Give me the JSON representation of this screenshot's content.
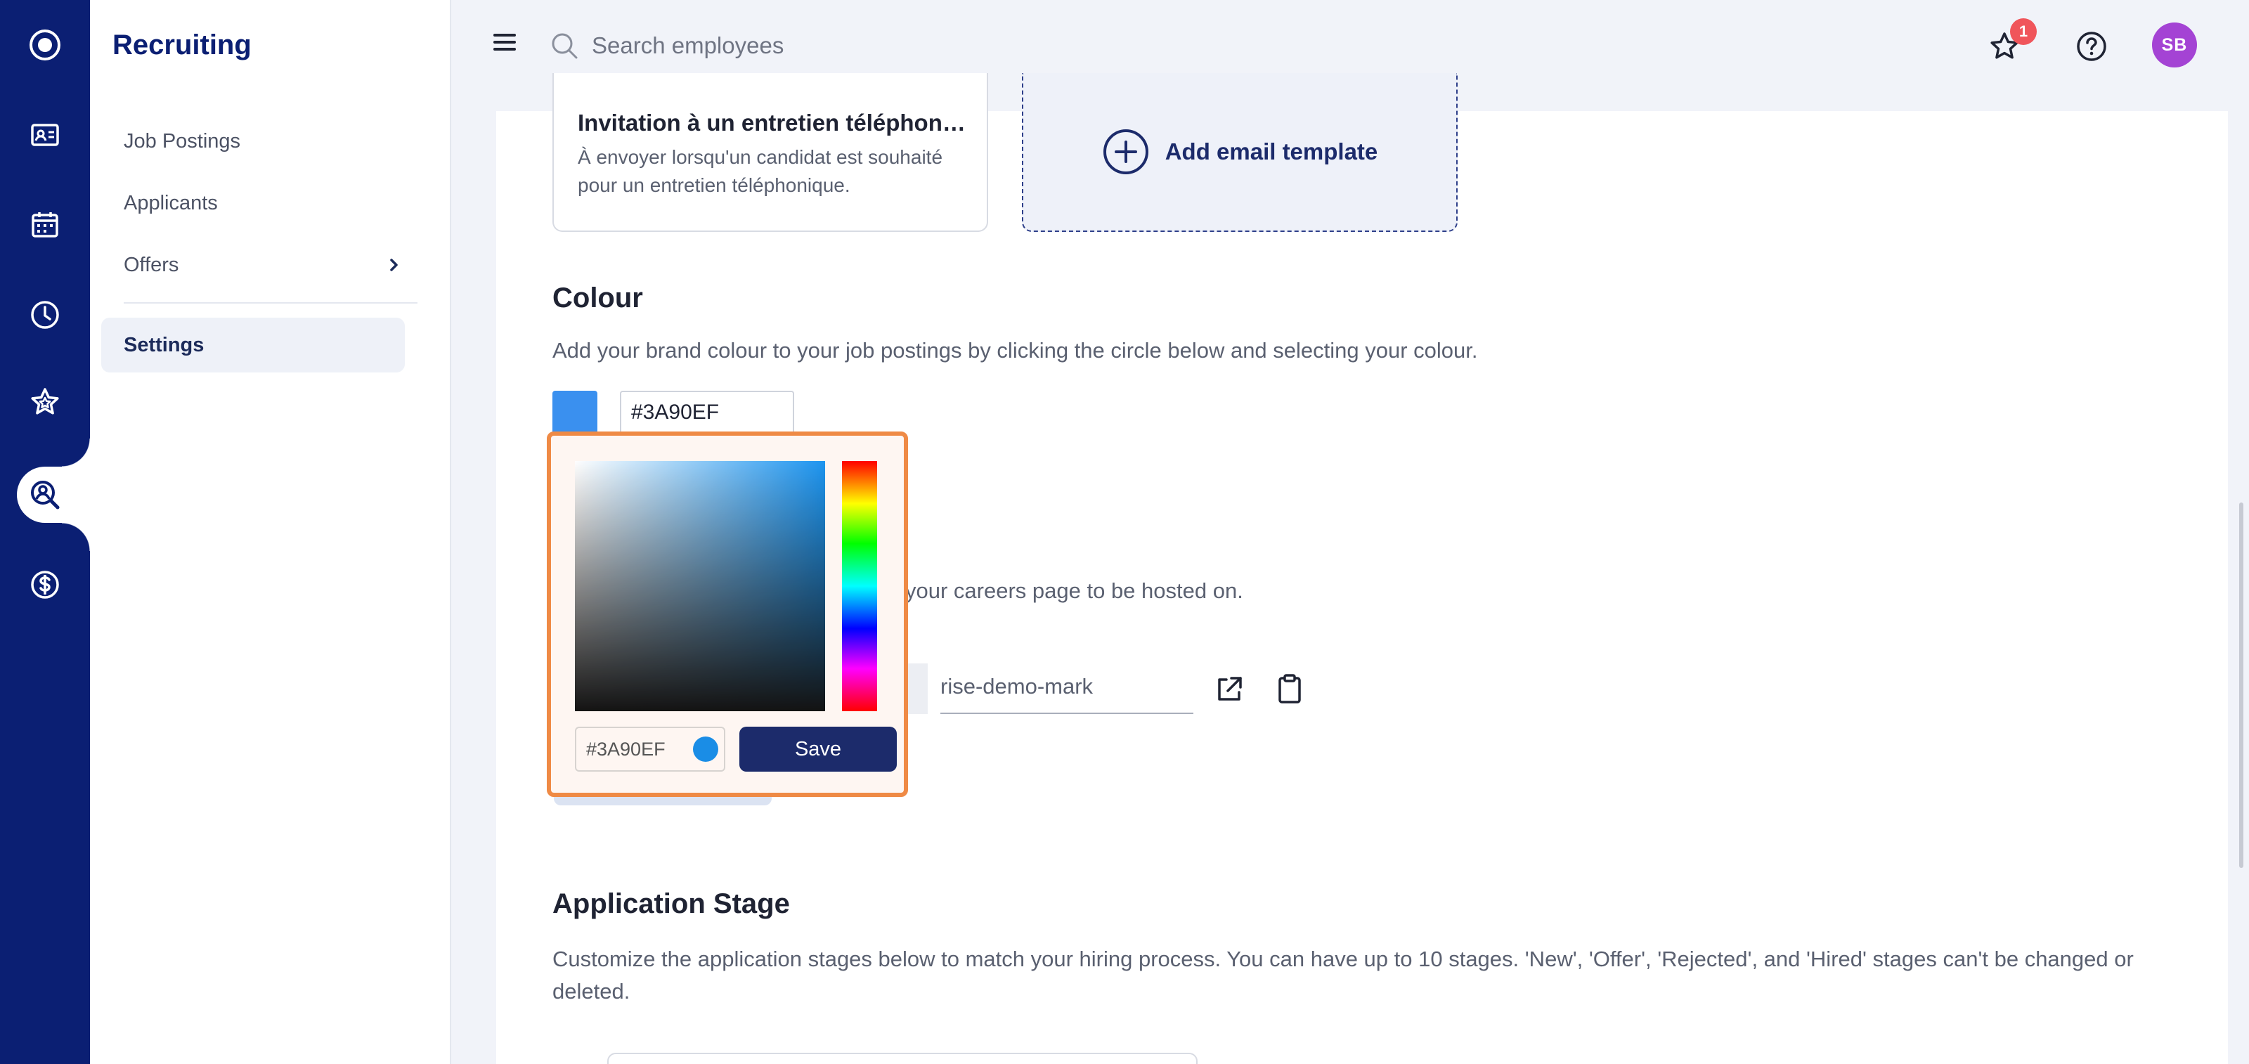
{
  "app": {
    "section_title": "Recruiting"
  },
  "rail": {
    "items": [
      {
        "icon": "logo-icon"
      },
      {
        "icon": "id-card-icon"
      },
      {
        "icon": "calendar-icon"
      },
      {
        "icon": "clock-icon"
      },
      {
        "icon": "star-icon"
      },
      {
        "icon": "search-person-icon",
        "active": true
      },
      {
        "icon": "dollar-icon"
      }
    ]
  },
  "subnav": {
    "items": [
      {
        "label": "Job Postings"
      },
      {
        "label": "Applicants"
      },
      {
        "label": "Offers"
      },
      {
        "label": "Settings",
        "active": true
      }
    ]
  },
  "topbar": {
    "search_placeholder": "Search employees",
    "notification_count": "1",
    "avatar_initials": "SB"
  },
  "email_templates": {
    "card_title": "Invitation à un entretien téléphonique",
    "card_desc": "À envoyer lorsqu'un candidat est souhaité pour un entretien téléphonique.",
    "add_label": "Add email template"
  },
  "colour": {
    "heading": "Colour",
    "description": "Add your brand colour to your job postings by clicking the circle below and selecting your colour.",
    "value": "#3A90EF"
  },
  "careers": {
    "partial_description": "your careers page to be hosted on.",
    "slug": "rise-demo-mark"
  },
  "picker": {
    "hex": "#3A90EF",
    "save_label": "Save"
  },
  "application_stage": {
    "heading": "Application Stage",
    "description": "Customize the application stages below to match your hiring process. You can have up to 10 stages. 'New', 'Offer', 'Rejected', and 'Hired' stages can't be changed or deleted."
  },
  "colors": {
    "rail": "#0b1f73",
    "accent": "#3a90ef",
    "primary_button": "#1c2b6b",
    "picker_border": "#ef8a45",
    "badge": "#f0555b",
    "avatar": "#a443d4"
  }
}
